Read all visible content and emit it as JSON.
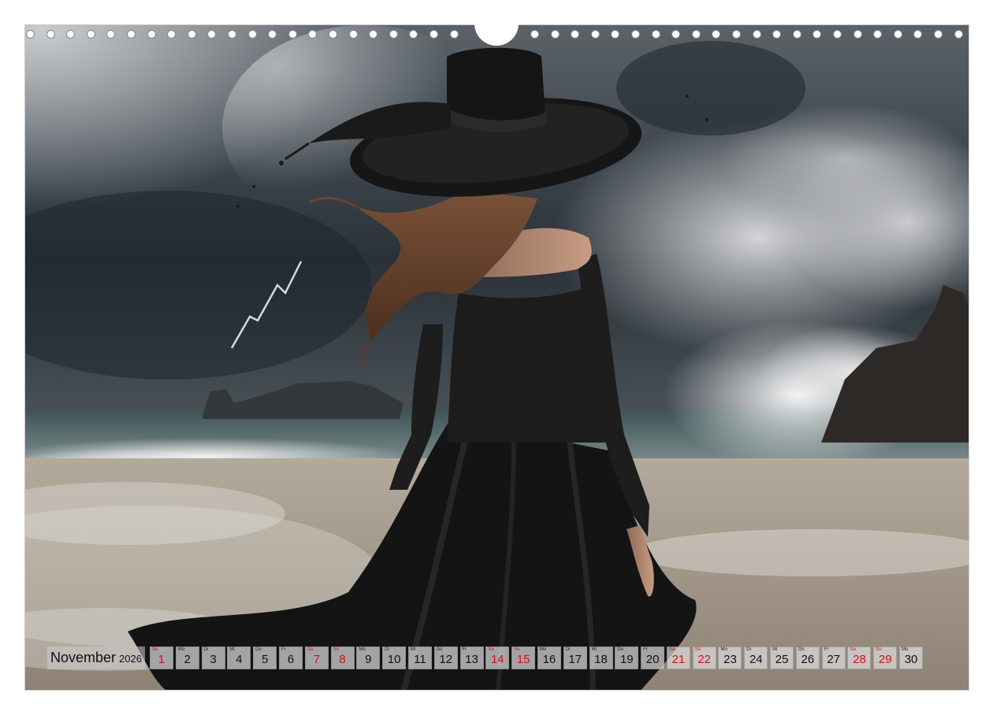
{
  "calendar": {
    "month": "November",
    "year": "2026",
    "days": [
      {
        "wd": "So",
        "n": "1",
        "red": true
      },
      {
        "wd": "Mo",
        "n": "2",
        "red": false
      },
      {
        "wd": "Di",
        "n": "3",
        "red": false
      },
      {
        "wd": "Mi",
        "n": "4",
        "red": false
      },
      {
        "wd": "Do",
        "n": "5",
        "red": false
      },
      {
        "wd": "Fr",
        "n": "6",
        "red": false
      },
      {
        "wd": "Sa",
        "n": "7",
        "red": true
      },
      {
        "wd": "So",
        "n": "8",
        "red": true
      },
      {
        "wd": "Mo",
        "n": "9",
        "red": false
      },
      {
        "wd": "Di",
        "n": "10",
        "red": false
      },
      {
        "wd": "Mi",
        "n": "11",
        "red": false
      },
      {
        "wd": "Do",
        "n": "12",
        "red": false
      },
      {
        "wd": "Fr",
        "n": "13",
        "red": false
      },
      {
        "wd": "Sa",
        "n": "14",
        "red": true
      },
      {
        "wd": "So",
        "n": "15",
        "red": true
      },
      {
        "wd": "Mo",
        "n": "16",
        "red": false
      },
      {
        "wd": "Di",
        "n": "17",
        "red": false
      },
      {
        "wd": "Mi",
        "n": "18",
        "red": false
      },
      {
        "wd": "Do",
        "n": "19",
        "red": false
      },
      {
        "wd": "Fr",
        "n": "20",
        "red": false
      },
      {
        "wd": "Sa",
        "n": "21",
        "red": true
      },
      {
        "wd": "So",
        "n": "22",
        "red": true
      },
      {
        "wd": "Mo",
        "n": "23",
        "red": false
      },
      {
        "wd": "Di",
        "n": "24",
        "red": false
      },
      {
        "wd": "Mi",
        "n": "25",
        "red": false
      },
      {
        "wd": "Do",
        "n": "26",
        "red": false
      },
      {
        "wd": "Fr",
        "n": "27",
        "red": false
      },
      {
        "wd": "Sa",
        "n": "28",
        "red": true
      },
      {
        "wd": "So",
        "n": "29",
        "red": true
      },
      {
        "wd": "Mo",
        "n": "30",
        "red": false
      }
    ]
  },
  "colors": {
    "weekend_red": "#d0101a",
    "sky_dark": "#2b3238",
    "sand": "#a89c8c",
    "dress": "#141414"
  }
}
